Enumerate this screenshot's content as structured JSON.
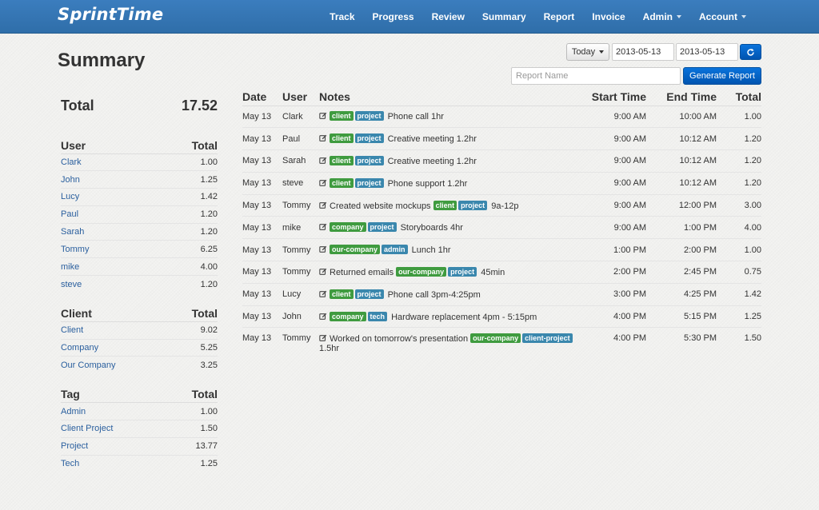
{
  "app": {
    "brand": "SprintTime"
  },
  "nav": [
    {
      "label": "Track",
      "caret": false
    },
    {
      "label": "Progress",
      "caret": false
    },
    {
      "label": "Review",
      "caret": false
    },
    {
      "label": "Summary",
      "caret": false
    },
    {
      "label": "Report",
      "caret": false
    },
    {
      "label": "Invoice",
      "caret": false
    },
    {
      "label": "Admin",
      "caret": true
    },
    {
      "label": "Account",
      "caret": true
    }
  ],
  "page": {
    "title": "Summary"
  },
  "controls": {
    "range_label": "Today",
    "start_date": "2013-05-13",
    "end_date": "2013-05-13",
    "refresh_icon": "refresh-icon",
    "report_name_placeholder": "Report Name",
    "generate_label": "Generate Report"
  },
  "summary": {
    "total_label": "Total",
    "total_value": "17.52",
    "user_table": {
      "heading": "User",
      "total_heading": "Total",
      "rows": [
        {
          "name": "Clark",
          "total": "1.00"
        },
        {
          "name": "John",
          "total": "1.25"
        },
        {
          "name": "Lucy",
          "total": "1.42"
        },
        {
          "name": "Paul",
          "total": "1.20"
        },
        {
          "name": "Sarah",
          "total": "1.20"
        },
        {
          "name": "Tommy",
          "total": "6.25"
        },
        {
          "name": "mike",
          "total": "4.00"
        },
        {
          "name": "steve",
          "total": "1.20"
        }
      ]
    },
    "client_table": {
      "heading": "Client",
      "total_heading": "Total",
      "rows": [
        {
          "name": "Client",
          "total": "9.02"
        },
        {
          "name": "Company",
          "total": "5.25"
        },
        {
          "name": "Our Company",
          "total": "3.25"
        }
      ]
    },
    "tag_table": {
      "heading": "Tag",
      "total_heading": "Total",
      "rows": [
        {
          "name": "Admin",
          "total": "1.00"
        },
        {
          "name": "Client Project",
          "total": "1.50"
        },
        {
          "name": "Project",
          "total": "13.77"
        },
        {
          "name": "Tech",
          "total": "1.25"
        }
      ]
    }
  },
  "entries": {
    "columns": {
      "date": "Date",
      "user": "User",
      "notes": "Notes",
      "start": "Start Time",
      "end": "End Time",
      "total": "Total"
    },
    "colors": {
      "client_tag": "#3f9b3f",
      "project_tag": "#3a87ad"
    },
    "rows": [
      {
        "date": "May 13",
        "user": "Clark",
        "before": "",
        "tags": [
          {
            "text": "client",
            "color": "green"
          },
          {
            "text": "project",
            "color": "blue"
          }
        ],
        "after": "Phone call 1hr",
        "start": "9:00 AM",
        "end": "10:00 AM",
        "total": "1.00"
      },
      {
        "date": "May 13",
        "user": "Paul",
        "before": "",
        "tags": [
          {
            "text": "client",
            "color": "green"
          },
          {
            "text": "project",
            "color": "blue"
          }
        ],
        "after": "Creative meeting 1.2hr",
        "start": "9:00 AM",
        "end": "10:12 AM",
        "total": "1.20"
      },
      {
        "date": "May 13",
        "user": "Sarah",
        "before": "",
        "tags": [
          {
            "text": "client",
            "color": "green"
          },
          {
            "text": "project",
            "color": "blue"
          }
        ],
        "after": "Creative meeting 1.2hr",
        "start": "9:00 AM",
        "end": "10:12 AM",
        "total": "1.20"
      },
      {
        "date": "May 13",
        "user": "steve",
        "before": "",
        "tags": [
          {
            "text": "client",
            "color": "green"
          },
          {
            "text": "project",
            "color": "blue"
          }
        ],
        "after": "Phone support 1.2hr",
        "start": "9:00 AM",
        "end": "10:12 AM",
        "total": "1.20"
      },
      {
        "date": "May 13",
        "user": "Tommy",
        "before": "Created website mockups",
        "tags": [
          {
            "text": "client",
            "color": "green"
          },
          {
            "text": "project",
            "color": "blue"
          }
        ],
        "after": "9a-12p",
        "start": "9:00 AM",
        "end": "12:00 PM",
        "total": "3.00"
      },
      {
        "date": "May 13",
        "user": "mike",
        "before": "",
        "tags": [
          {
            "text": "company",
            "color": "green"
          },
          {
            "text": "project",
            "color": "blue"
          }
        ],
        "after": "Storyboards 4hr",
        "start": "9:00 AM",
        "end": "1:00 PM",
        "total": "4.00"
      },
      {
        "date": "May 13",
        "user": "Tommy",
        "before": "",
        "tags": [
          {
            "text": "our-company",
            "color": "green"
          },
          {
            "text": "admin",
            "color": "blue"
          }
        ],
        "after": "Lunch 1hr",
        "start": "1:00 PM",
        "end": "2:00 PM",
        "total": "1.00"
      },
      {
        "date": "May 13",
        "user": "Tommy",
        "before": "Returned emails",
        "tags": [
          {
            "text": "our-company",
            "color": "green"
          },
          {
            "text": "project",
            "color": "blue"
          }
        ],
        "after": "45min",
        "start": "2:00 PM",
        "end": "2:45 PM",
        "total": "0.75"
      },
      {
        "date": "May 13",
        "user": "Lucy",
        "before": "",
        "tags": [
          {
            "text": "client",
            "color": "green"
          },
          {
            "text": "project",
            "color": "blue"
          }
        ],
        "after": "Phone call 3pm-4:25pm",
        "start": "3:00 PM",
        "end": "4:25 PM",
        "total": "1.42"
      },
      {
        "date": "May 13",
        "user": "John",
        "before": "",
        "tags": [
          {
            "text": "company",
            "color": "green"
          },
          {
            "text": "tech",
            "color": "blue"
          }
        ],
        "after": "Hardware replacement 4pm - 5:15pm",
        "start": "4:00 PM",
        "end": "5:15 PM",
        "total": "1.25"
      },
      {
        "date": "May 13",
        "user": "Tommy",
        "before": "Worked on tomorrow's presentation",
        "tags": [
          {
            "text": "our-company",
            "color": "green"
          },
          {
            "text": "client-project",
            "color": "blue"
          }
        ],
        "after": "1.5hr",
        "start": "4:00 PM",
        "end": "5:30 PM",
        "total": "1.50"
      }
    ]
  }
}
